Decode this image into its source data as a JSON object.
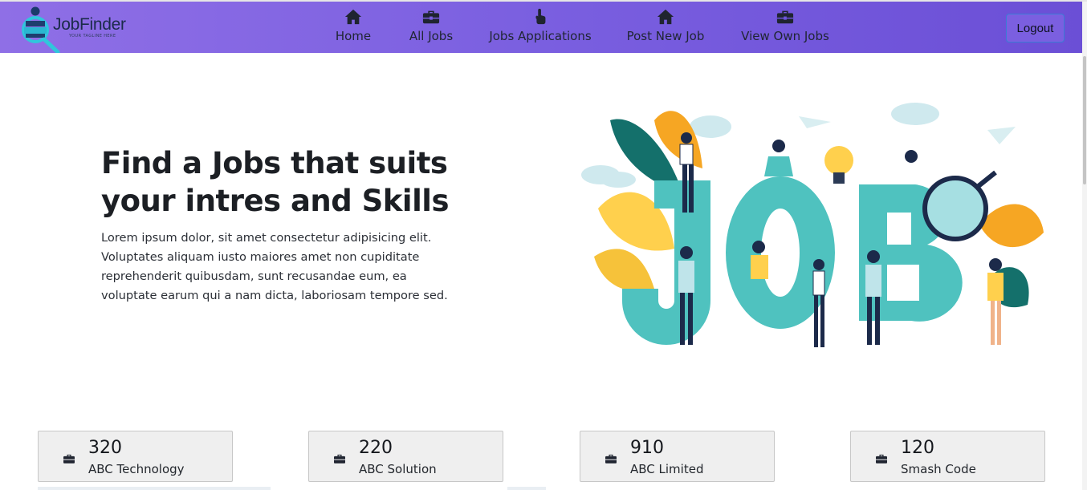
{
  "brand": {
    "name": "JobFinder",
    "tagline": "YOUR TAGLINE HERE"
  },
  "nav": {
    "items": [
      {
        "label": "Home",
        "icon": "home-icon"
      },
      {
        "label": "All Jobs",
        "icon": "briefcase-icon"
      },
      {
        "label": "Jobs Applications",
        "icon": "hand-pointer-icon"
      },
      {
        "label": "Post New Job",
        "icon": "home-icon"
      },
      {
        "label": "View Own Jobs",
        "icon": "briefcase-icon"
      }
    ],
    "logout_label": "Logout"
  },
  "hero": {
    "title": "Find a Jobs that suits your intres and Skills",
    "description": "Lorem ipsum dolor, sit amet consectetur adipisicing elit. Voluptates aliquam iusto maiores amet non cupiditate reprehenderit quibusdam, sunt recusandae eum, ea voluptate earum qui a nam dicta, laboriosam tempore sed.",
    "illustration_text": "JOB"
  },
  "stats": [
    {
      "count": "320",
      "company": "ABC Technology",
      "icon": "briefcase-icon"
    },
    {
      "count": "220",
      "company": "ABC Solution",
      "icon": "briefcase-icon"
    },
    {
      "count": "910",
      "company": "ABC Limited",
      "icon": "briefcase-icon"
    },
    {
      "count": "120",
      "company": "Smash Code",
      "icon": "briefcase-icon"
    }
  ],
  "colors": {
    "navbar": "#7a5fe0",
    "teal": "#4fc2bf",
    "accent_orange": "#f6a623",
    "dark_green": "#14706b"
  }
}
